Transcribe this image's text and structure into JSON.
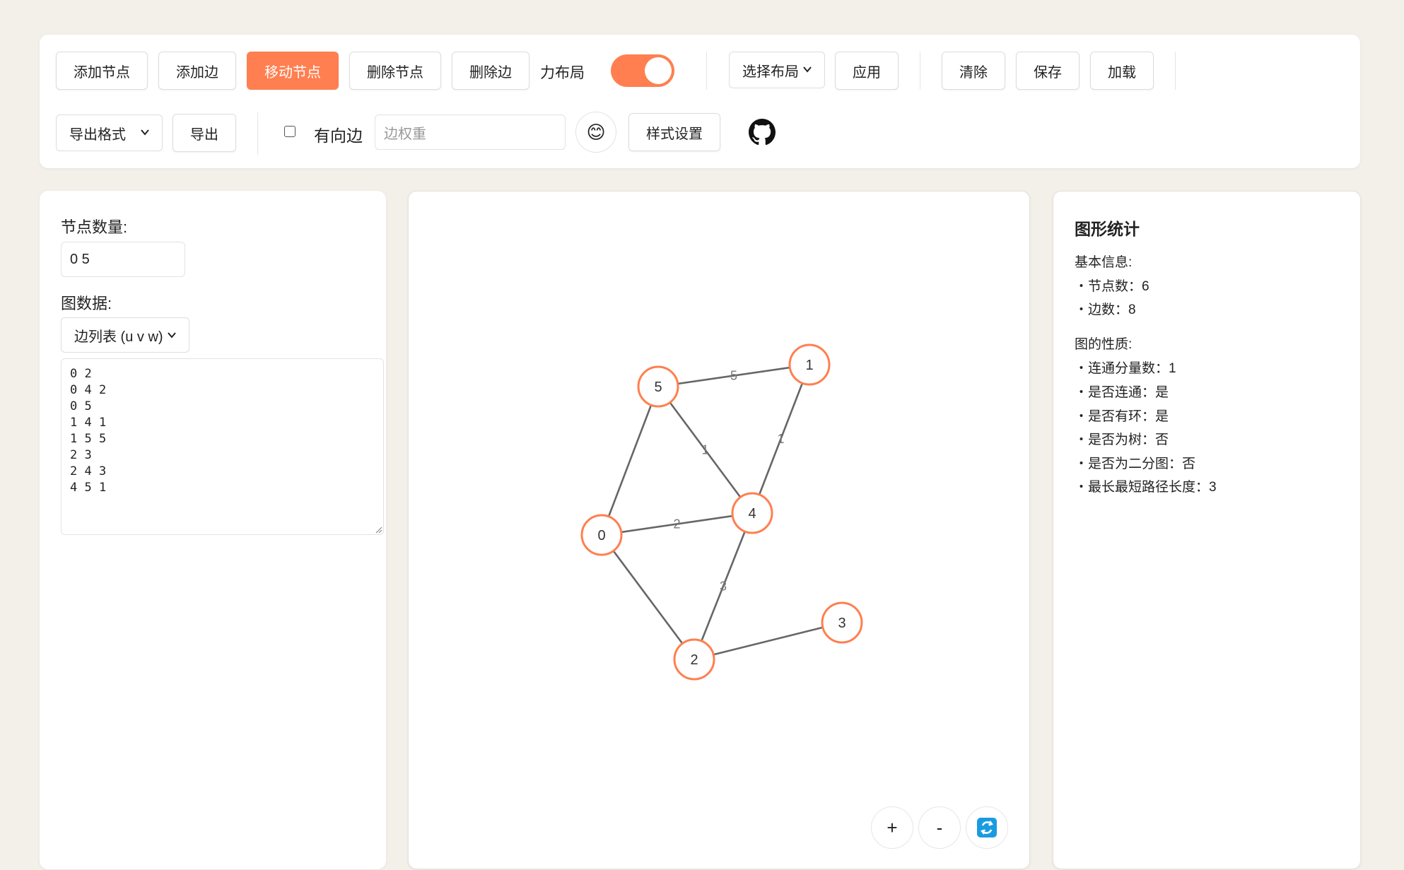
{
  "toolbar": {
    "add_node": "添加节点",
    "add_edge": "添加边",
    "move_node": "移动节点",
    "delete_node": "删除节点",
    "delete_edge": "删除边",
    "force_layout_label": "力布局",
    "force_layout_on": true,
    "layout_select": "选择布局",
    "apply": "应用",
    "clear": "清除",
    "save": "保存",
    "load": "加载",
    "export_format": "导出格式",
    "export": "导出",
    "directed_label": "有向边",
    "directed_checked": false,
    "edge_weight_placeholder": "边权重",
    "emoji": "😊",
    "style_settings": "样式设置",
    "github_icon": "github-icon",
    "accent_color": "#ff7f50"
  },
  "left_panel": {
    "node_count_label": "节点数量:",
    "node_count_value": "0 5",
    "graph_data_label": "图数据:",
    "format_select": "边列表 (u v w)",
    "edges_text": "0 2\n0 4 2\n0 5\n1 4 1\n1 5 5\n2 3\n2 4 3\n4 5 1"
  },
  "graph": {
    "nodes": [
      {
        "id": "0",
        "label": "0"
      },
      {
        "id": "1",
        "label": "1"
      },
      {
        "id": "2",
        "label": "2"
      },
      {
        "id": "3",
        "label": "3"
      },
      {
        "id": "4",
        "label": "4"
      },
      {
        "id": "5",
        "label": "5"
      }
    ],
    "edges": [
      {
        "u": "0",
        "v": "2",
        "w": ""
      },
      {
        "u": "0",
        "v": "4",
        "w": "2"
      },
      {
        "u": "0",
        "v": "5",
        "w": ""
      },
      {
        "u": "1",
        "v": "4",
        "w": "1"
      },
      {
        "u": "1",
        "v": "5",
        "w": "5"
      },
      {
        "u": "2",
        "v": "3",
        "w": ""
      },
      {
        "u": "2",
        "v": "4",
        "w": "3"
      },
      {
        "u": "4",
        "v": "5",
        "w": "1"
      }
    ],
    "node_stroke": "#ff7f50",
    "edge_color": "#666666"
  },
  "zoom": {
    "plus": "+",
    "minus": "-",
    "reset_icon": "refresh-icon"
  },
  "stats": {
    "title": "图形统计",
    "basic_header": "基本信息:",
    "node_count": "・节点数：6",
    "edge_count": "・边数：8",
    "props_header": "图的性质:",
    "components": "・连通分量数：1",
    "connected": "・是否连通：是",
    "has_cycle": "・是否有环：是",
    "is_tree": "・是否为树：否",
    "is_bipartite": "・是否为二分图：否",
    "diameter": "・最长最短路径长度：3"
  }
}
